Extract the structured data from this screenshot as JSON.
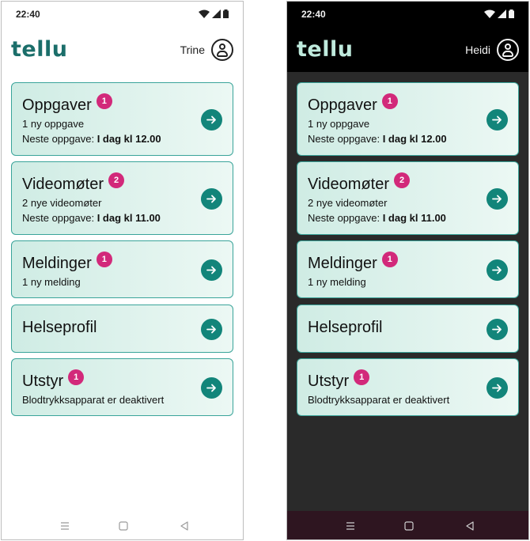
{
  "screens": [
    {
      "theme": "light",
      "time": "22:40",
      "logo": "tellu",
      "user_name": "Trine",
      "cards": [
        {
          "title": "Oppgaver",
          "badge": "1",
          "line1": "1 ny oppgave",
          "line2_label": "Neste oppgave: ",
          "line2_value": "I dag kl 12.00"
        },
        {
          "title": "Videomøter",
          "badge": "2",
          "line1": "2 nye videomøter",
          "line2_label": "Neste oppgave: ",
          "line2_value": "I dag kl 11.00"
        },
        {
          "title": "Meldinger",
          "badge": "1",
          "line1": "1 ny melding"
        },
        {
          "title": "Helseprofil"
        },
        {
          "title": "Utstyr",
          "badge": "1",
          "line1": "Blodtrykksapparat er deaktivert"
        }
      ]
    },
    {
      "theme": "dark",
      "time": "22:40",
      "logo": "tellu",
      "user_name": "Heidi",
      "cards": [
        {
          "title": "Oppgaver",
          "badge": "1",
          "line1": "1 ny oppgave",
          "line2_label": "Neste oppgave: ",
          "line2_value": "I dag kl 12.00"
        },
        {
          "title": "Videomøter",
          "badge": "2",
          "line1": "2 nye videomøter",
          "line2_label": "Neste oppgave: ",
          "line2_value": "I dag kl 11.00"
        },
        {
          "title": "Meldinger",
          "badge": "1",
          "line1": "1 ny melding"
        },
        {
          "title": "Helseprofil"
        },
        {
          "title": "Utstyr",
          "badge": "1",
          "line1": "Blodtrykksapparat er deaktivert"
        }
      ]
    }
  ],
  "icons": {
    "status": [
      "wifi-icon",
      "signal-icon",
      "battery-icon"
    ],
    "card_action": "arrow-right-icon",
    "user": "user-avatar-icon",
    "nav": [
      "menu-icon",
      "home-icon",
      "back-icon"
    ]
  },
  "colors": {
    "accent": "#12857a",
    "badge": "#d2297a",
    "card_border": "#3aa49a",
    "dark_nav": "#2e1520"
  }
}
